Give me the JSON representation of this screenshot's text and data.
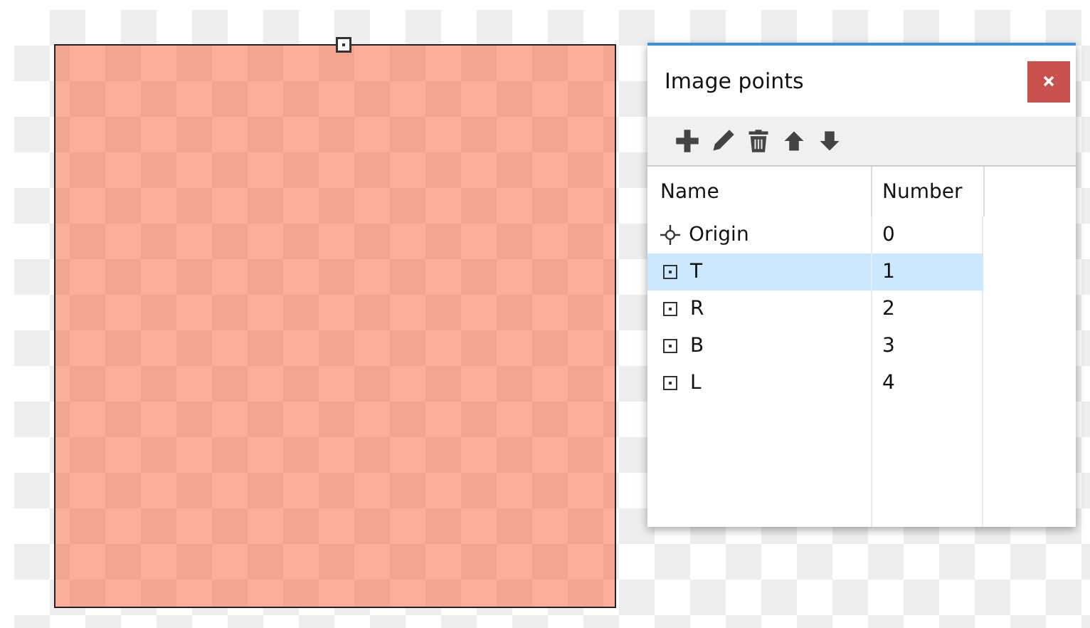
{
  "panel": {
    "title": "Image points"
  },
  "toolbar": [
    {
      "kind": "add"
    },
    {
      "kind": "edit"
    },
    {
      "kind": "delete"
    },
    {
      "kind": "up"
    },
    {
      "kind": "down"
    }
  ],
  "table": {
    "columns": [
      "Name",
      "Number"
    ],
    "rows": [
      {
        "kind": "origin",
        "name": "Origin",
        "number": "0",
        "selected": false
      },
      {
        "kind": "point",
        "name": "T",
        "number": "1",
        "selected": true
      },
      {
        "kind": "point",
        "name": "R",
        "number": "2",
        "selected": false
      },
      {
        "kind": "point",
        "name": "B",
        "number": "3",
        "selected": false
      },
      {
        "kind": "point",
        "name": "L",
        "number": "4",
        "selected": false
      }
    ]
  }
}
